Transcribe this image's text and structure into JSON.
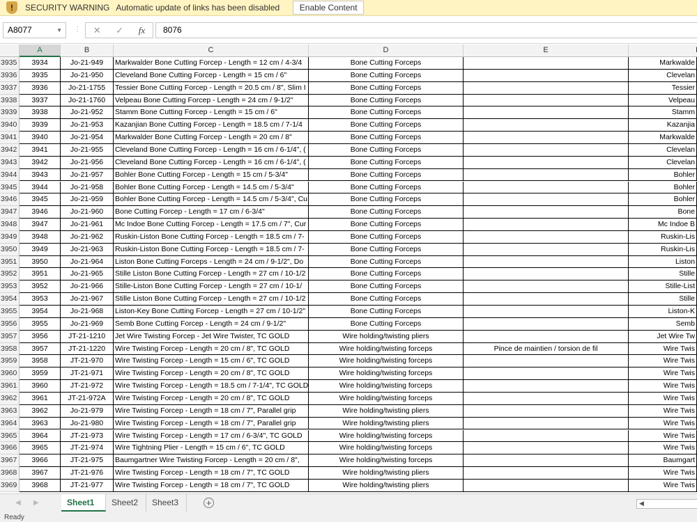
{
  "security_bar": {
    "icon": "shield-warning-icon",
    "title": "SECURITY WARNING",
    "message": "Automatic update of links has been disabled",
    "button": "Enable Content"
  },
  "formula_bar": {
    "name_box": "A8077",
    "cancel": "✕",
    "enter": "✓",
    "fx": "fx",
    "value": "8076"
  },
  "columns": [
    "A",
    "B",
    "C",
    "D",
    "E",
    "F"
  ],
  "selected_column": "A",
  "rows": [
    {
      "n": "3935",
      "a": "3934",
      "b": "Jo-21-949",
      "c": "Markwalder Bone Cutting Forcep - Length = 12 cm / 4-3/4",
      "d": "Bone Cutting Forceps",
      "e": "",
      "f": "Markwalde"
    },
    {
      "n": "3936",
      "a": "3935",
      "b": "Jo-21-950",
      "c": "Cleveland Bone Cutting Forcep - Length = 15 cm / 6\"",
      "d": "Bone Cutting Forceps",
      "e": "",
      "f": "Clevelan"
    },
    {
      "n": "3937",
      "a": "3936",
      "b": "Jo-21-1755",
      "c": "Tessier Bone Cutting Forcep - Length = 20.5 cm / 8\", Slim I",
      "d": "Bone Cutting Forceps",
      "e": "",
      "f": "Tessier"
    },
    {
      "n": "3938",
      "a": "3937",
      "b": "Jo-21-1760",
      "c": "Velpeau  Bone Cutting Forcep - Length = 24 cm / 9-1/2\"",
      "d": "Bone Cutting Forceps",
      "e": "",
      "f": "Velpeau"
    },
    {
      "n": "3939",
      "a": "3938",
      "b": "Jo-21-952",
      "c": "Stamm Bone Cutting Forcep - Length = 15 cm / 6\"",
      "d": "Bone Cutting Forceps",
      "e": "",
      "f": "Stamm"
    },
    {
      "n": "3940",
      "a": "3939",
      "b": "Jo-21-953",
      "c": "Kazanjian Bone Cutting Forcep - Length = 18.5 cm / 7-1/4",
      "d": "Bone Cutting Forceps",
      "e": "",
      "f": "Kazanjia"
    },
    {
      "n": "3941",
      "a": "3940",
      "b": "Jo-21-954",
      "c": "Markwalder Bone Cutting Forcep - Length = 20 cm / 8\"",
      "d": "Bone Cutting Forceps",
      "e": "",
      "f": "Markwalde"
    },
    {
      "n": "3942",
      "a": "3941",
      "b": "Jo-21-955",
      "c": "Cleveland Bone Cutting Forcep - Length = 16 cm / 6-1/4\", (",
      "d": "Bone Cutting Forceps",
      "e": "",
      "f": "Clevelan"
    },
    {
      "n": "3943",
      "a": "3942",
      "b": "Jo-21-956",
      "c": "Cleveland Bone Cutting Forcep - Length = 16 cm / 6-1/4\", (",
      "d": "Bone Cutting Forceps",
      "e": "",
      "f": "Clevelan"
    },
    {
      "n": "3944",
      "a": "3943",
      "b": "Jo-21-957",
      "c": "Bohler Bone Cutting Forcep - Length = 15 cm / 5-3/4\"",
      "d": "Bone Cutting Forceps",
      "e": "",
      "f": "Bohler"
    },
    {
      "n": "3945",
      "a": "3944",
      "b": "Jo-21-958",
      "c": "Bohler Bone Cutting Forcep - Length = 14.5 cm / 5-3/4\"",
      "d": "Bone Cutting Forceps",
      "e": "",
      "f": "Bohler"
    },
    {
      "n": "3946",
      "a": "3945",
      "b": "Jo-21-959",
      "c": "Bohler Bone Cutting Forcep - Length = 14.5 cm / 5-3/4\", Cu",
      "d": "Bone Cutting Forceps",
      "e": "",
      "f": "Bohler"
    },
    {
      "n": "3947",
      "a": "3946",
      "b": "Jo-21-960",
      "c": "Bone Cutting Forcep - Length = 17 cm / 6-3/4\"",
      "d": "Bone Cutting Forceps",
      "e": "",
      "f": "Bone"
    },
    {
      "n": "3948",
      "a": "3947",
      "b": "Jo-21-961",
      "c": "Mc Indoe Bone Cutting Forcep - Length = 17.5 cm / 7\", Cur",
      "d": "Bone Cutting Forceps",
      "e": "",
      "f": "Mc Indoe  B"
    },
    {
      "n": "3949",
      "a": "3948",
      "b": "Jo-21-962",
      "c": "Ruskin-Liston Bone Cutting Forcep - Length = 18.5 cm / 7-",
      "d": "Bone Cutting Forceps",
      "e": "",
      "f": "Ruskin-Lis"
    },
    {
      "n": "3950",
      "a": "3949",
      "b": "Jo-21-963",
      "c": "Ruskin-Liston Bone Cutting Forcep - Length = 18.5 cm / 7-",
      "d": "Bone Cutting Forceps",
      "e": "",
      "f": "Ruskin-Lis"
    },
    {
      "n": "3951",
      "a": "3950",
      "b": "Jo-21-964",
      "c": "Liston Bone Cutting Forceps - Length = 24 cm / 9-1/2\", Do",
      "d": "Bone Cutting Forceps",
      "e": "",
      "f": "Liston"
    },
    {
      "n": "3952",
      "a": "3951",
      "b": "Jo-21-965",
      "c": "Stille Liston Bone Cutting Forcep - Length = 27 cm / 10-1/2",
      "d": "Bone Cutting Forceps",
      "e": "",
      "f": "Stille"
    },
    {
      "n": "3953",
      "a": "3952",
      "b": "Jo-21-966",
      "c": "Stille-Liston Bone Cutting Forcep - Length = 27 cm / 10-1/",
      "d": "Bone Cutting Forceps",
      "e": "",
      "f": "Stille-List"
    },
    {
      "n": "3954",
      "a": "3953",
      "b": "Jo-21-967",
      "c": "Stille Liston Bone Cutting Forcep - Length = 27 cm / 10-1/2",
      "d": "Bone Cutting Forceps",
      "e": "",
      "f": "Stille"
    },
    {
      "n": "3955",
      "a": "3954",
      "b": "Jo-21-968",
      "c": "Liston-Key Bone Cutting Forcep - Length = 27 cm / 10-1/2\"",
      "d": "Bone Cutting Forceps",
      "e": "",
      "f": "Liston-K"
    },
    {
      "n": "3956",
      "a": "3955",
      "b": "Jo-21-969",
      "c": "Semb Bone Cutting Forcep - Length = 24 cm / 9-1/2\"",
      "d": "Bone Cutting Forceps",
      "e": "",
      "f": "Semb"
    },
    {
      "n": "3957",
      "a": "3956",
      "b": "JT-21-1210",
      "c": "Jet Wire Twisting Forcep - Jet Wire Twister, TC GOLD",
      "d": "Wire holding/twisting pliers",
      "e": "",
      "f": "Jet Wire Tw"
    },
    {
      "n": "3958",
      "a": "3957",
      "b": "JT-21-1220",
      "c": "Wire Twisting Forcep - Length = 20 cm / 8\", TC GOLD",
      "d": "Wire holding/twisting forceps",
      "e": "Pince de maintien / torsion de fil",
      "f": "Wire Twis"
    },
    {
      "n": "3959",
      "a": "3958",
      "b": "JT-21-970",
      "c": "Wire Twisting Forcep - Length = 15 cm / 6\", TC GOLD",
      "d": "Wire holding/twisting forceps",
      "e": "",
      "f": "Wire Twis"
    },
    {
      "n": "3960",
      "a": "3959",
      "b": "JT-21-971",
      "c": "Wire Twisting Forcep - Length = 20 cm / 8\", TC GOLD",
      "d": "Wire holding/twisting forceps",
      "e": "",
      "f": "Wire Twis"
    },
    {
      "n": "3961",
      "a": "3960",
      "b": "JT-21-972",
      "c": "Wire Twisting Forcep - Length = 18.5 cm / 7-1/4\", TC GOLD",
      "d": "Wire holding/twisting forceps",
      "e": "",
      "f": "Wire Twis"
    },
    {
      "n": "3962",
      "a": "3961",
      "b": "JT-21-972A",
      "c": "Wire Twisting Forcep - Length = 20 cm / 8\", TC GOLD",
      "d": "Wire holding/twisting forceps",
      "e": "",
      "f": "Wire Twis"
    },
    {
      "n": "3963",
      "a": "3962",
      "b": "Jo-21-979",
      "c": "Wire Twisting Forcep - Length = 18 cm / 7\", Parallel grip",
      "d": "Wire holding/twisting pliers",
      "e": "",
      "f": "Wire Twis"
    },
    {
      "n": "3964",
      "a": "3963",
      "b": "Jo-21-980",
      "c": "Wire Twisting Forcep - Length = 18 cm / 7\", Parallel grip",
      "d": "Wire holding/twisting pliers",
      "e": "",
      "f": "Wire Twis"
    },
    {
      "n": "3965",
      "a": "3964",
      "b": "JT-21-973",
      "c": "Wire Twisting Forcep - Length = 17 cm / 6-3/4\", TC GOLD",
      "d": "Wire holding/twisting forceps",
      "e": "",
      "f": "Wire Twis"
    },
    {
      "n": "3966",
      "a": "3965",
      "b": "JT-21-974",
      "c": "Wire Tightning Plier - Length = 15 cm / 6\", TC GOLD",
      "d": "Wire holding/twisting forceps",
      "e": "",
      "f": "Wire Twis"
    },
    {
      "n": "3967",
      "a": "3966",
      "b": "JT-21-975",
      "c": "Baumgartner Wire Twisting Forcep - Length = 20 cm / 8\",",
      "d": "Wire holding/twisting forceps",
      "e": "",
      "f": "Baumgart"
    },
    {
      "n": "3968",
      "a": "3967",
      "b": "JT-21-976",
      "c": "Wire Twisting Forcep - Length = 18 cm / 7\", TC GOLD",
      "d": "Wire holding/twisting pliers",
      "e": "",
      "f": "Wire Twis"
    },
    {
      "n": "3969",
      "a": "3968",
      "b": "JT-21-977",
      "c": "Wire Twisting Forcep - Length = 18 cm / 7\", TC GOLD",
      "d": "Wire holding/twisting pliers",
      "e": "",
      "f": "Wire Twis"
    }
  ],
  "sheet_tabs": [
    {
      "label": "Sheet1",
      "active": true
    },
    {
      "label": "Sheet2",
      "active": false
    },
    {
      "label": "Sheet3",
      "active": false
    }
  ],
  "add_sheet": "+",
  "status": "Ready",
  "colors": {
    "accent": "#217346",
    "warning_bg": "#fff4c2"
  }
}
